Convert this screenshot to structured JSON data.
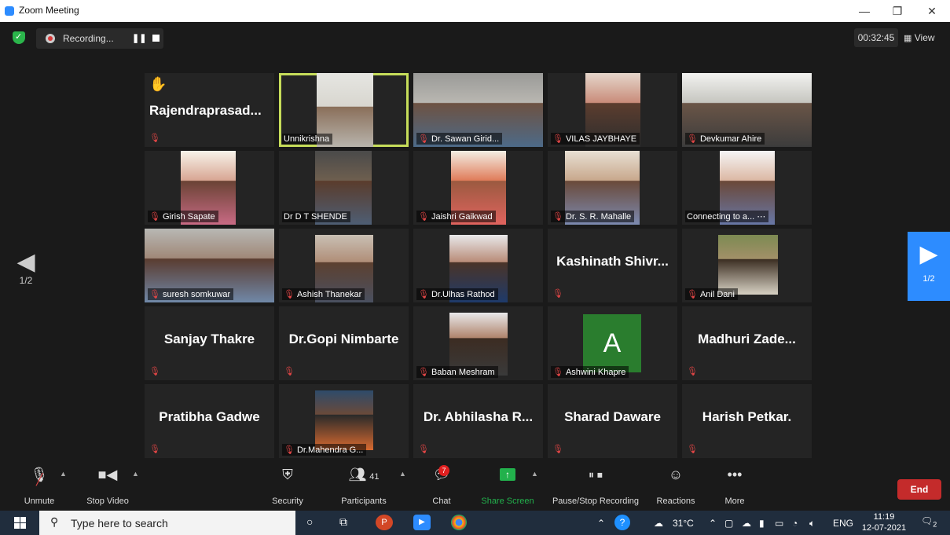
{
  "window": {
    "title": "Zoom Meeting",
    "controls": [
      "—",
      "❐",
      "✕"
    ]
  },
  "topbar": {
    "recording_label": "Recording...",
    "timer": "00:32:45",
    "view_label": "View"
  },
  "nav": {
    "left_page": "1/2",
    "right_page": "1/2"
  },
  "tiles": [
    {
      "name": "Rajendraprasad...",
      "kind": "big",
      "hand": true
    },
    {
      "name": "Unnikrishna",
      "kind": "video",
      "active": true,
      "muted": false
    },
    {
      "name": "Dr. Sawan Girid...",
      "kind": "video",
      "muted": true
    },
    {
      "name": "VILAS JAYBHAYE",
      "kind": "video",
      "muted": true
    },
    {
      "name": "Devkumar Ahire",
      "kind": "video",
      "muted": true
    },
    {
      "name": "Girish Sapate",
      "kind": "video",
      "muted": true
    },
    {
      "name": "Dr D T SHENDE",
      "kind": "video",
      "muted": false
    },
    {
      "name": "Jaishri Gaikwad",
      "kind": "video",
      "muted": true
    },
    {
      "name": "Dr. S. R. Mahalle",
      "kind": "video",
      "muted": true
    },
    {
      "name": "Connecting to a... ⋯",
      "kind": "video",
      "muted": false
    },
    {
      "name": "suresh somkuwar",
      "kind": "video",
      "muted": true
    },
    {
      "name": "Ashish Thanekar",
      "kind": "video",
      "muted": true
    },
    {
      "name": "Dr.Ulhas Rathod",
      "kind": "video",
      "muted": true
    },
    {
      "name": "Kashinath Shivr...",
      "kind": "big"
    },
    {
      "name": "Anil Dani",
      "kind": "video",
      "muted": true
    },
    {
      "name": "Sanjay Thakre",
      "kind": "big"
    },
    {
      "name": "Dr.Gopi Nimbarte",
      "kind": "big"
    },
    {
      "name": "Baban Meshram",
      "kind": "video",
      "muted": true
    },
    {
      "name": "Ashwini Khapre",
      "kind": "avatar",
      "initial": "A",
      "muted": true
    },
    {
      "name": "Madhuri Zade...",
      "kind": "big"
    },
    {
      "name": "Pratibha Gadwe",
      "kind": "big"
    },
    {
      "name": "Dr.Mahendra G...",
      "kind": "video",
      "muted": true
    },
    {
      "name": "Dr. Abhilasha R...",
      "kind": "big"
    },
    {
      "name": "Sharad Daware",
      "kind": "big"
    },
    {
      "name": "Harish Petkar.",
      "kind": "big"
    }
  ],
  "toolbar": {
    "unmute": "Unmute",
    "stop_video": "Stop Video",
    "security": "Security",
    "participants": "Participants",
    "participants_count": "41",
    "chat": "Chat",
    "chat_badge": "7",
    "share_screen": "Share Screen",
    "pause_stop_recording": "Pause/Stop Recording",
    "reactions": "Reactions",
    "more": "More",
    "end": "End"
  },
  "taskbar": {
    "search_placeholder": "Type here to search",
    "temperature": "31°C",
    "language": "ENG",
    "time": "11:19",
    "date": "12-07-2021",
    "notification_count": "2"
  },
  "colors": {
    "active_speaker": "#c6dd5a",
    "share_green": "#22b14c",
    "end_red": "#c42b2b",
    "nav_blue": "#2d8cff",
    "mute_red": "#e04545"
  }
}
